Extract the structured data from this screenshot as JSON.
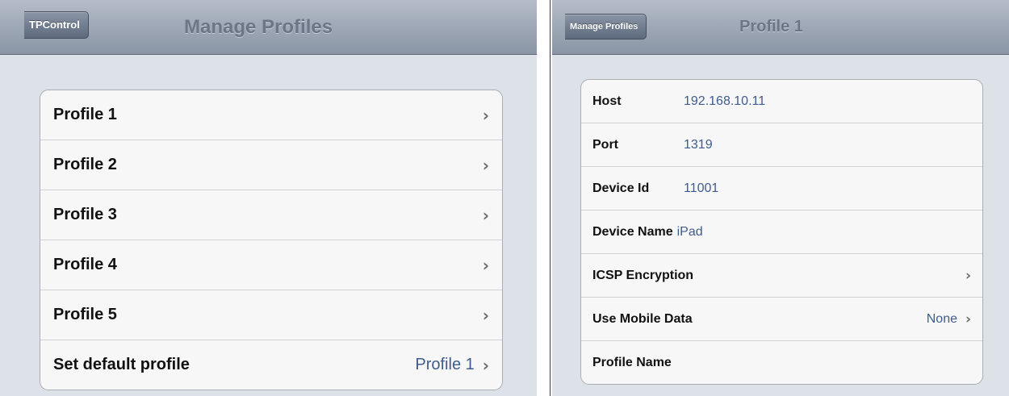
{
  "left": {
    "back_label": "TPControl",
    "title": "Manage Profiles",
    "rows": [
      {
        "label": "Profile 1",
        "value": ""
      },
      {
        "label": "Profile 2",
        "value": ""
      },
      {
        "label": "Profile 3",
        "value": ""
      },
      {
        "label": "Profile 4",
        "value": ""
      },
      {
        "label": "Profile 5",
        "value": ""
      },
      {
        "label": "Set default profile",
        "value": "Profile 1"
      }
    ]
  },
  "right": {
    "back_label": "Manage Profiles",
    "title": "Profile 1",
    "fields": [
      {
        "label": "Host",
        "value": "192.168.10.11"
      },
      {
        "label": "Port",
        "value": "1319"
      },
      {
        "label": "Device Id",
        "value": "11001"
      },
      {
        "label": "Device Name",
        "value": "iPad"
      }
    ],
    "nav_rows": [
      {
        "label": "ICSP Encryption",
        "value": ""
      },
      {
        "label": "Use Mobile Data",
        "value": "None"
      }
    ],
    "profile_name_label": "Profile Name"
  },
  "icons": {
    "chevron": "chevron-right-icon",
    "back": "back-arrow-icon"
  },
  "colors": {
    "navbar": "#9ea8b6",
    "value_text": "#3f5c8e",
    "background": "#dde1e8"
  }
}
